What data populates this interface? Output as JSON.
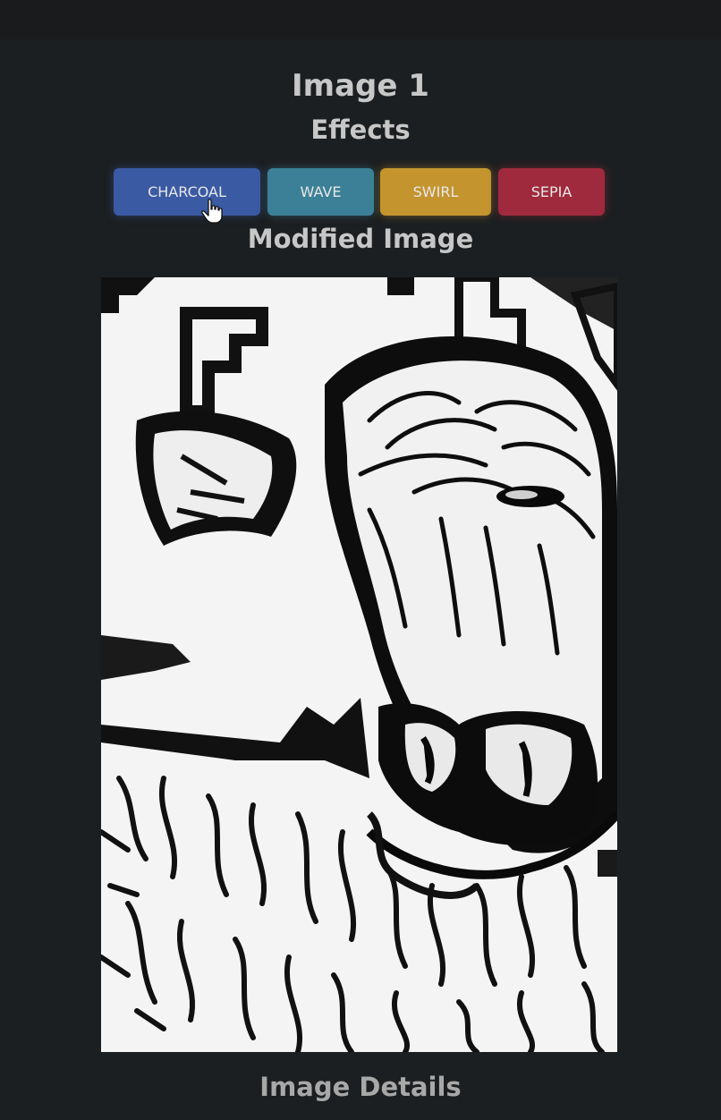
{
  "page": {
    "title": "Image 1",
    "effects_heading": "Effects",
    "modified_heading": "Modified Image",
    "details_heading": "Image Details"
  },
  "effects": {
    "buttons": [
      {
        "label": "CHARCOAL",
        "color": "#3a5aa3"
      },
      {
        "label": "WAVE",
        "color": "#3b8096"
      },
      {
        "label": "SWIRL",
        "color": "#c4942f"
      },
      {
        "label": "SEPIA",
        "color": "#a02a3d"
      }
    ]
  },
  "image": {
    "description_icon": "charcoal-cow-image"
  },
  "colors": {
    "background": "#1c1f21",
    "topbar": "#191b1d"
  }
}
